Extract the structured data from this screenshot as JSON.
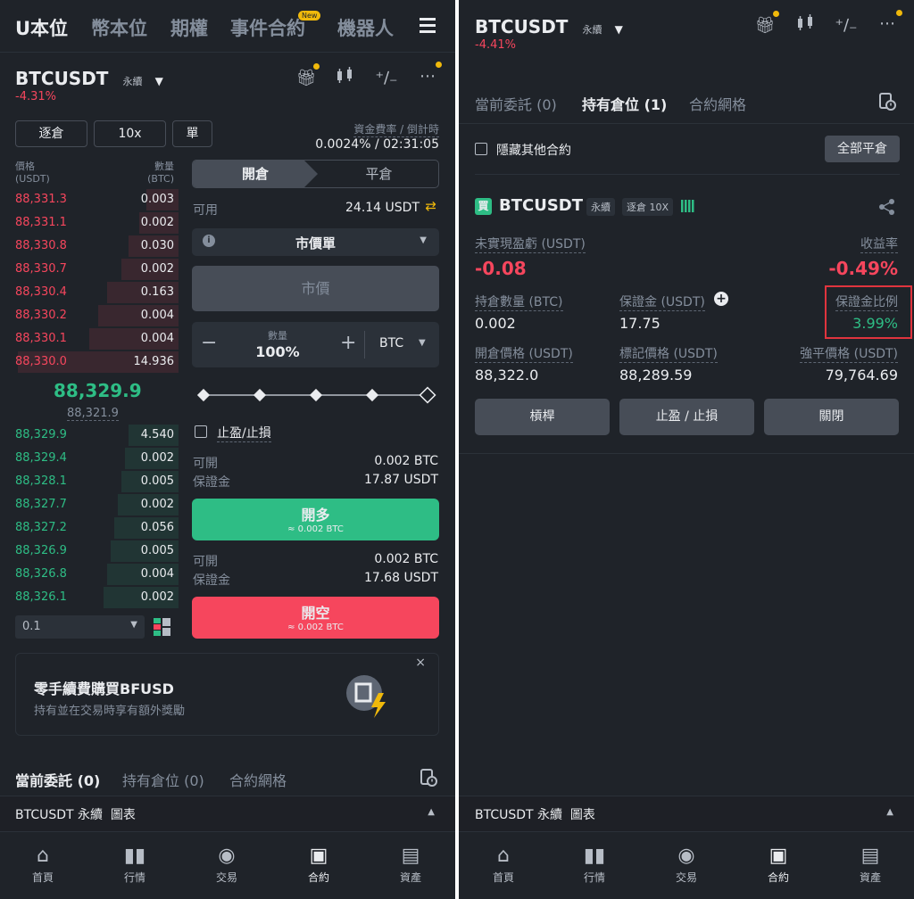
{
  "left": {
    "topnav": [
      {
        "label": "U本位",
        "active": true
      },
      {
        "label": "幣本位",
        "active": false
      },
      {
        "label": "期權",
        "active": false
      },
      {
        "label": "事件合約",
        "active": false,
        "badge": "New"
      },
      {
        "label": "機器人",
        "active": false
      }
    ],
    "menu_icon": "hamburger-icon",
    "symbol": "BTCUSDT",
    "contract_type": "永續",
    "change": "-4.31%",
    "margin_mode": "逐倉",
    "leverage": "10x",
    "position_mode": "單",
    "funding_label": "資金費率 / 倒計時",
    "funding_value": "0.0024% / 02:31:05",
    "orderbook": {
      "price_header": "價格",
      "price_unit": "(USDT)",
      "qty_header": "數量",
      "qty_unit": "(BTC)",
      "asks": [
        {
          "price": "88,331.3",
          "qty": "0.003",
          "depth": 0.18
        },
        {
          "price": "88,331.1",
          "qty": "0.002",
          "depth": 0.22
        },
        {
          "price": "88,330.8",
          "qty": "0.030",
          "depth": 0.28
        },
        {
          "price": "88,330.7",
          "qty": "0.002",
          "depth": 0.32
        },
        {
          "price": "88,330.4",
          "qty": "0.163",
          "depth": 0.4
        },
        {
          "price": "88,330.2",
          "qty": "0.004",
          "depth": 0.45
        },
        {
          "price": "88,330.1",
          "qty": "0.004",
          "depth": 0.5
        },
        {
          "price": "88,330.0",
          "qty": "14.936",
          "depth": 0.9
        }
      ],
      "last_price": "88,329.9",
      "mark_price": "88,321.9",
      "bids": [
        {
          "price": "88,329.9",
          "qty": "4.540",
          "depth": 0.28
        },
        {
          "price": "88,329.4",
          "qty": "0.002",
          "depth": 0.3
        },
        {
          "price": "88,328.1",
          "qty": "0.005",
          "depth": 0.32
        },
        {
          "price": "88,327.7",
          "qty": "0.002",
          "depth": 0.34
        },
        {
          "price": "88,327.2",
          "qty": "0.056",
          "depth": 0.36
        },
        {
          "price": "88,326.9",
          "qty": "0.005",
          "depth": 0.38
        },
        {
          "price": "88,326.8",
          "qty": "0.004",
          "depth": 0.4
        },
        {
          "price": "88,326.1",
          "qty": "0.002",
          "depth": 0.42
        }
      ],
      "precision": "0.1"
    },
    "order": {
      "open_tab": "開倉",
      "close_tab": "平倉",
      "available_label": "可用",
      "available_value": "24.14 USDT",
      "order_type": "市價單",
      "price_placeholder": "市價",
      "qty_label": "數量",
      "qty_value": "100%",
      "qty_unit": "BTC",
      "tpsl_label": "止盈/止損",
      "long_open_label": "可開",
      "long_open_value": "0.002 BTC",
      "long_margin_label": "保證金",
      "long_margin_value": "17.87 USDT",
      "long_button": "開多",
      "long_button_sub": "≈ 0.002 BTC",
      "short_open_label": "可開",
      "short_open_value": "0.002 BTC",
      "short_margin_label": "保證金",
      "short_margin_value": "17.68 USDT",
      "short_button": "開空",
      "short_button_sub": "≈ 0.002 BTC"
    },
    "promo": {
      "title": "零手續費購買BFUSD",
      "subtitle": "持有並在交易時享有額外獎勵"
    },
    "tabs": [
      {
        "label": "當前委託 (0)",
        "active": true
      },
      {
        "label": "持有倉位 (0)",
        "active": false
      },
      {
        "label": "合約網格",
        "active": false
      }
    ],
    "chart_bar": "BTCUSDT 永續  圖表"
  },
  "right": {
    "symbol": "BTCUSDT",
    "contract_type": "永續",
    "change": "-4.41%",
    "tabs": [
      {
        "label": "當前委託 (0)",
        "active": false
      },
      {
        "label": "持有倉位 (1)",
        "active": true
      },
      {
        "label": "合約網格",
        "active": false
      }
    ],
    "hide_other_label": "隱藏其他合約",
    "close_all_button": "全部平倉",
    "position": {
      "side_badge": "買",
      "symbol": "BTCUSDT",
      "contract_type": "永續",
      "margin_leverage": "逐倉 10X",
      "unrealized_label": "未實現盈虧 (USDT)",
      "unrealized_value": "-0.08",
      "roe_label": "收益率",
      "roe_value": "-0.49%",
      "size_label": "持倉數量 (BTC)",
      "size_value": "0.002",
      "margin_label": "保證金 (USDT)",
      "margin_value": "17.75",
      "margin_ratio_label": "保證金比例",
      "margin_ratio_value": "3.99%",
      "entry_label": "開倉價格 (USDT)",
      "entry_value": "88,322.0",
      "mark_label": "標記價格 (USDT)",
      "mark_value": "88,289.59",
      "liq_label": "強平價格 (USDT)",
      "liq_value": "79,764.69",
      "btn_leverage": "槓桿",
      "btn_tpsl": "止盈 / 止損",
      "btn_close": "關閉"
    },
    "chart_bar": "BTCUSDT 永續  圖表"
  },
  "bottom_nav": [
    {
      "label": "首頁",
      "icon": "home-icon",
      "active": false
    },
    {
      "label": "行情",
      "icon": "markets-icon",
      "active": false
    },
    {
      "label": "交易",
      "icon": "trade-icon",
      "active": false
    },
    {
      "label": "合約",
      "icon": "futures-icon",
      "active": true
    },
    {
      "label": "資產",
      "icon": "wallet-icon",
      "active": false
    }
  ],
  "colors": {
    "background": "#1f2329",
    "buy": "#2ebd85",
    "sell": "#f6465d",
    "accent": "#f0b90b",
    "highlight_box": "#e0343e"
  }
}
